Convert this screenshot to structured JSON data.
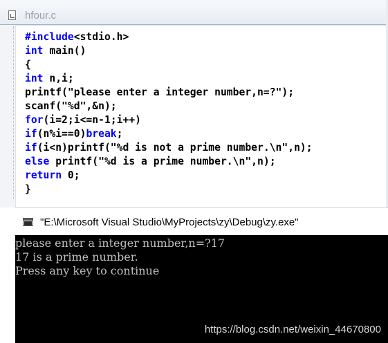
{
  "editor": {
    "filename": "hfour.c",
    "lines": [
      [
        {
          "t": "#include",
          "kw": true
        },
        {
          "t": "<stdio.h>",
          "kw": false
        }
      ],
      [
        {
          "t": "int",
          "kw": true
        },
        {
          "t": " main()",
          "kw": false
        }
      ],
      [
        {
          "t": "{",
          "kw": false
        }
      ],
      [
        {
          "t": "int",
          "kw": true
        },
        {
          "t": " n,i;",
          "kw": false
        }
      ],
      [
        {
          "t": "printf(\"please enter a integer number,n=?\");",
          "kw": false
        }
      ],
      [
        {
          "t": "scanf(\"%d\",&n);",
          "kw": false
        }
      ],
      [
        {
          "t": "for",
          "kw": true
        },
        {
          "t": "(i=2;i<=n-1;i++)",
          "kw": false
        }
      ],
      [
        {
          "t": "if",
          "kw": true
        },
        {
          "t": "(n%i==0)",
          "kw": false
        },
        {
          "t": "break",
          "kw": true
        },
        {
          "t": ";",
          "kw": false
        }
      ],
      [
        {
          "t": "if",
          "kw": true
        },
        {
          "t": "(i<n)printf(\"%d is not a prime number.\\n\",n);",
          "kw": false
        }
      ],
      [
        {
          "t": "else",
          "kw": true
        },
        {
          "t": " printf(\"%d is a prime number.\\n\",n);",
          "kw": false
        }
      ],
      [
        {
          "t": "return",
          "kw": true
        },
        {
          "t": " 0;",
          "kw": false
        }
      ],
      [
        {
          "t": "}",
          "kw": false
        }
      ]
    ],
    "colors": {
      "keyword": "#0000ff",
      "text": "#000000"
    }
  },
  "console": {
    "title": "\"E:\\Microsoft Visual Studio\\MyProjects\\zy\\Debug\\zy.exe\"",
    "output": [
      "please enter a integer number,n=?17",
      "17 is a prime number.",
      "Press any key to continue"
    ],
    "watermark": "https://blog.csdn.net/weixin_44670800",
    "colors": {
      "background": "#000000",
      "text": "#c0c0c0"
    }
  }
}
